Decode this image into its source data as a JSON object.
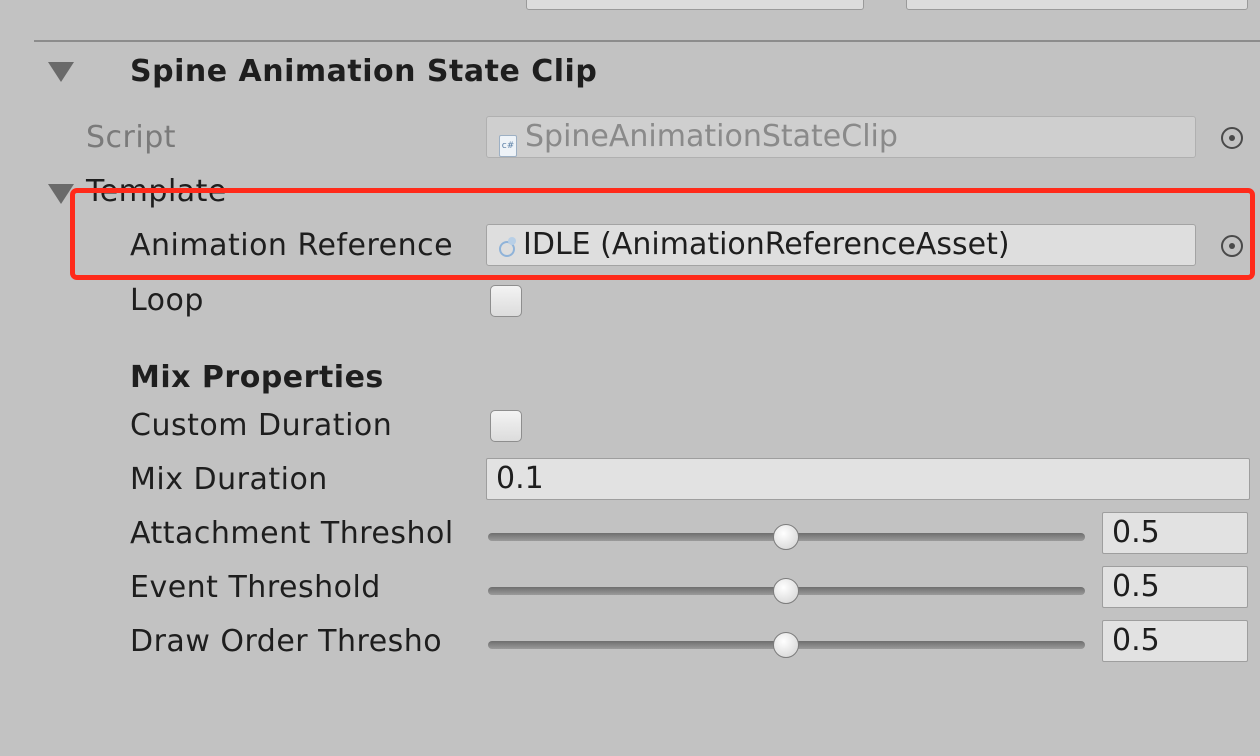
{
  "component": {
    "title": "Spine Animation State Clip",
    "script_label": "Script",
    "script_value": "SpineAnimationStateClip"
  },
  "template": {
    "label": "Template",
    "animation_reference_label": "Animation Reference",
    "animation_reference_value": "IDLE (AnimationReferenceAsset)",
    "loop_label": "Loop",
    "loop_checked": false
  },
  "mix": {
    "header": "Mix Properties",
    "custom_duration_label": "Custom Duration",
    "custom_duration_checked": false,
    "mix_duration_label": "Mix Duration",
    "mix_duration_value": "0.1",
    "attachment_threshold_label": "Attachment Threshol",
    "attachment_threshold_value": "0.5",
    "event_threshold_label": "Event Threshold",
    "event_threshold_value": "0.5",
    "draw_order_threshold_label": "Draw Order Thresho",
    "draw_order_threshold_value": "0.5"
  },
  "icons": {
    "script_icon": "cs-script-icon",
    "asset_icon": "animation-reference-asset-icon",
    "picker_icon": "object-picker-icon",
    "foldout_icon": "foldout-triangle-icon"
  },
  "colors": {
    "highlight": "#ff2a1a",
    "background": "#c2c2c2"
  }
}
